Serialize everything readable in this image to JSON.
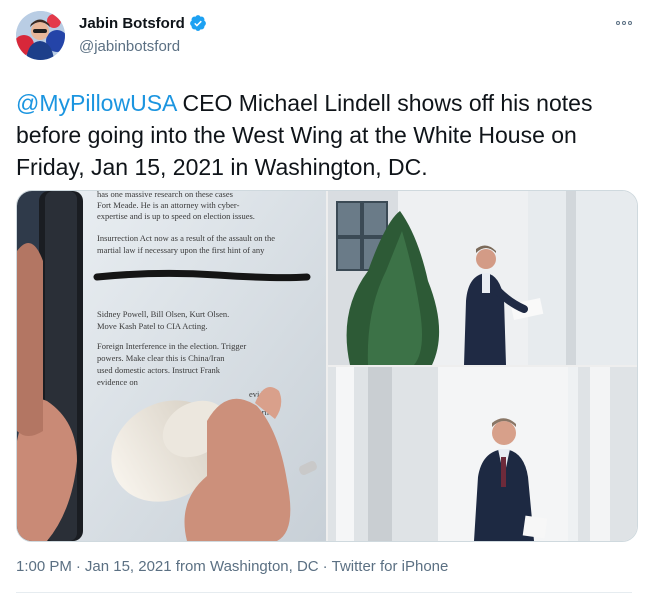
{
  "author": {
    "display_name": "Jabin Botsford",
    "handle": "@jabinbotsford",
    "verified": true,
    "avatar_icon": "user-avatar"
  },
  "tweet": {
    "mention": "@MyPillowUSA",
    "text_rest": " CEO Michael Lindell shows off his notes before going into the West Wing at the White House on Friday, Jan 15, 2021 in Washington, DC."
  },
  "media": {
    "notes_lines": [
      "has one massive research on these cases",
      "Fort Meade. He is an attorney with cyber-",
      "expertise and is up to speed on election issues.",
      "Insurrection Act now as a result of the assault on the",
      "martial law if necessary upon the first hint of any",
      "Sidney Powell, Bill Olsen, Kurt Olsen.",
      "Move Kash Patel to CIA Acting.",
      "Foreign Interference in the election. Trigger",
      "powers. Make clear this is China/Iran",
      "used domestic actors. Instruct Frank",
      "evidence on",
      "evidence",
      "attorney"
    ]
  },
  "footer": {
    "time": "1:00 PM",
    "date": "Jan 15, 2021",
    "from_label": "from",
    "location": "Washington, DC",
    "client": "Twitter for iPhone",
    "separator": "·"
  },
  "colors": {
    "accent": "#1b95e0",
    "secondary_text": "#5b7083",
    "verified_badge": "#1da1f2"
  }
}
